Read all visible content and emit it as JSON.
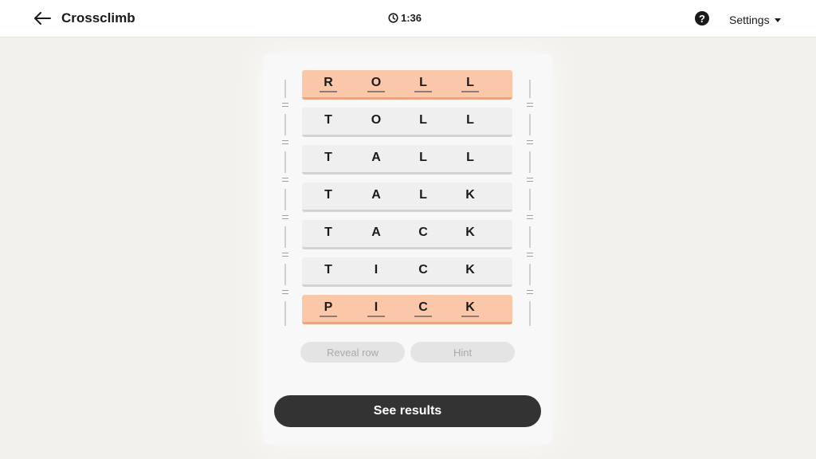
{
  "header": {
    "back_icon": "arrow-left-icon",
    "title": "Crossclimb",
    "timer_icon": "clock-icon",
    "timer": "1:36",
    "help_icon": "question-circle-icon",
    "help_glyph": "?",
    "settings_label": "Settings"
  },
  "board": {
    "rows": [
      {
        "letters": [
          "R",
          "O",
          "L",
          "L"
        ],
        "fixed": true
      },
      {
        "letters": [
          "T",
          "O",
          "L",
          "L"
        ],
        "fixed": false
      },
      {
        "letters": [
          "T",
          "A",
          "L",
          "L"
        ],
        "fixed": false
      },
      {
        "letters": [
          "T",
          "A",
          "L",
          "K"
        ],
        "fixed": false
      },
      {
        "letters": [
          "T",
          "A",
          "C",
          "K"
        ],
        "fixed": false
      },
      {
        "letters": [
          "T",
          "I",
          "C",
          "K"
        ],
        "fixed": false
      },
      {
        "letters": [
          "P",
          "I",
          "C",
          "K"
        ],
        "fixed": true
      }
    ],
    "colors": {
      "fixed_row": "#fbc7a9",
      "normal_row": "#efefef"
    }
  },
  "actions": {
    "reveal_row": "Reveal row",
    "hint": "Hint",
    "see_results": "See results"
  }
}
